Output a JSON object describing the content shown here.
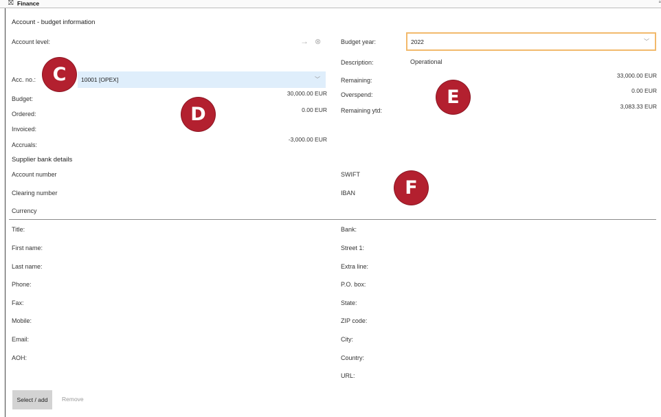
{
  "window": {
    "title": "Finance",
    "icon": "finance-app-icon",
    "maximize_icon": "restore-icon"
  },
  "section": {
    "title": "Account - budget information"
  },
  "account": {
    "level_label": "Account level:",
    "acc_no_label": "Acc. no.:",
    "acc_no_value": "10001 [OPEX]",
    "budget_label": "Budget:",
    "budget_value": "30,000.00  EUR",
    "ordered_label": "Ordered:",
    "ordered_value": "0.00  EUR",
    "invoiced_label": "Invoiced:",
    "accruals_label": "Accruals:",
    "accruals_value": "-3,000.00  EUR"
  },
  "budget_year": {
    "label": "Budget year:",
    "value": "2022",
    "description_label": "Description:",
    "description_value": "Operational",
    "remaining_label": "Remaining:",
    "remaining_value": "33,000.00  EUR",
    "overspend_label": "Overspend:",
    "overspend_value": "0.00  EUR",
    "remaining_ytd_label": "Remaining ytd:",
    "remaining_ytd_value": "3,083.33  EUR"
  },
  "supplier_bank": {
    "title": "Supplier bank details",
    "account_number_label": "Account number",
    "clearing_number_label": "Clearing number",
    "currency_label": "Currency",
    "swift_label": "SWIFT",
    "iban_label": "IBAN"
  },
  "contact": {
    "title_label": "Title:",
    "first_name_label": "First name:",
    "last_name_label": "Last name:",
    "phone_label": "Phone:",
    "fax_label": "Fax:",
    "mobile_label": "Mobile:",
    "email_label": "Email:",
    "aoh_label": "AOH:"
  },
  "address": {
    "bank_label": "Bank:",
    "street1_label": "Street 1:",
    "extra_line_label": "Extra line:",
    "po_box_label": "P.O. box:",
    "state_label": "State:",
    "zip_label": "ZIP code:",
    "city_label": "City:",
    "country_label": "Country:",
    "url_label": "URL:"
  },
  "buttons": {
    "select_add": "Select / add",
    "remove": "Remove"
  },
  "callouts": {
    "c": "C",
    "d": "D",
    "e": "E",
    "f": "F"
  },
  "colors": {
    "callout": "#b3202f",
    "acc_select_bg": "#dfeefb",
    "year_select_border": "#f2b96b"
  }
}
